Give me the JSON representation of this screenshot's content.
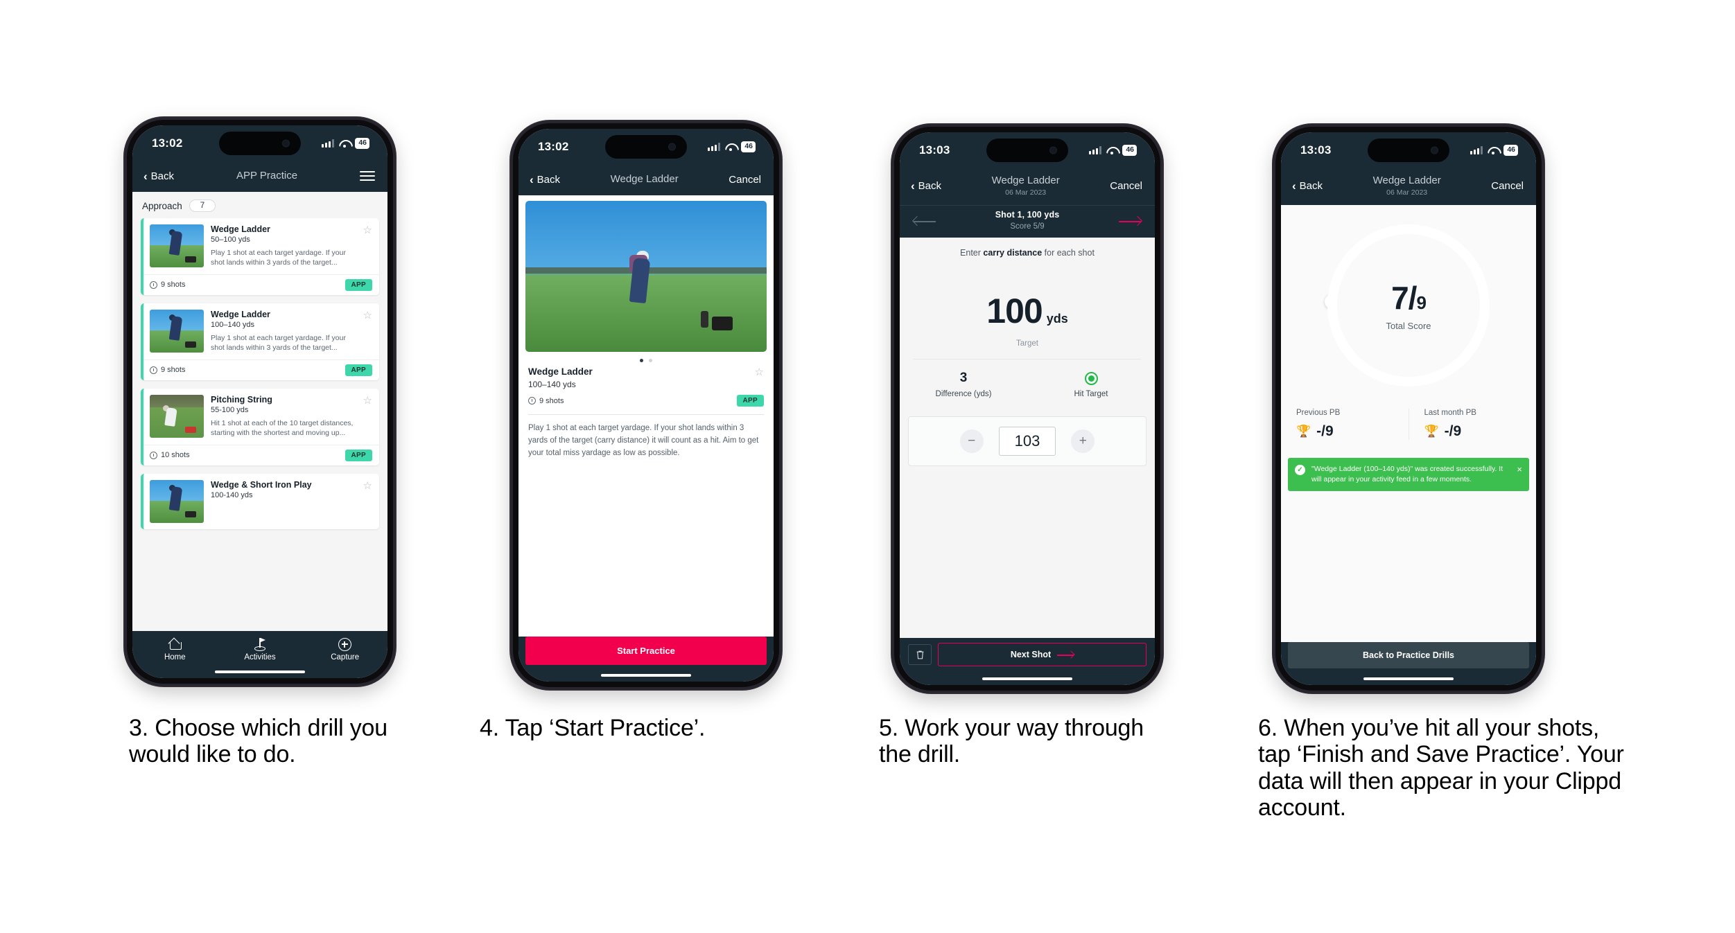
{
  "page": {
    "background": "#ffffff",
    "accent_pink": "#f2004e",
    "accent_teal": "#3ed6ab",
    "dark_navy": "#1b2b36",
    "success_green": "#3cbf4e"
  },
  "phones": [
    {
      "status": {
        "time": "13:02",
        "battery": "46"
      },
      "nav": {
        "back": "Back",
        "title": "APP Practice",
        "menu": "hamburger-icon"
      },
      "section": {
        "title": "Approach",
        "count": "7"
      },
      "cards": [
        {
          "title": "Wedge Ladder",
          "yards": "50–100 yds",
          "desc": "Play 1 shot at each target yardage. If your shot lands within 3 yards of the target...",
          "shots": "9 shots",
          "tag": "APP"
        },
        {
          "title": "Wedge Ladder",
          "yards": "100–140 yds",
          "desc": "Play 1 shot at each target yardage. If your shot lands within 3 yards of the target...",
          "shots": "9 shots",
          "tag": "APP"
        },
        {
          "title": "Pitching String",
          "yards": "55-100 yds",
          "desc": "Hit 1 shot at each of the 10 target distances, starting with the shortest and moving up...",
          "shots": "10 shots",
          "tag": "APP"
        },
        {
          "title": "Wedge & Short Iron Play",
          "yards": "100-140 yds",
          "desc": "",
          "shots": "",
          "tag": ""
        }
      ],
      "tabs": [
        {
          "label": "Home",
          "icon": "home-icon"
        },
        {
          "label": "Activities",
          "icon": "golf-flag-icon"
        },
        {
          "label": "Capture",
          "icon": "plus-circle-icon"
        }
      ]
    },
    {
      "status": {
        "time": "13:02",
        "battery": "46"
      },
      "nav": {
        "back": "Back",
        "title": "Wedge Ladder",
        "cancel": "Cancel"
      },
      "detail": {
        "title": "Wedge Ladder",
        "yards": "100–140 yds",
        "shots": "9 shots",
        "tag": "APP",
        "description": "Play 1 shot at each target yardage. If your shot lands within 3 yards of the target (carry distance) it will count as a hit. Aim to get your total miss yardage as low as possible."
      },
      "cta": "Start Practice"
    },
    {
      "status": {
        "time": "13:03",
        "battery": "46"
      },
      "nav": {
        "back": "Back",
        "title": "Wedge Ladder",
        "subtitle": "06 Mar 2023",
        "cancel": "Cancel"
      },
      "shotnav": {
        "title": "Shot 1, 100 yds",
        "score": "Score 5/9"
      },
      "prompt_before": "Enter ",
      "prompt_bold": "carry distance",
      "prompt_after": " for each shot",
      "target": {
        "value": "100",
        "unit": "yds",
        "label": "Target"
      },
      "stats": [
        {
          "value": "3",
          "label": "Difference (yds)"
        },
        {
          "value": "hit-target-icon",
          "label": "Hit Target"
        }
      ],
      "stepper": {
        "minus": "−",
        "value": "103",
        "plus": "+"
      },
      "footer": {
        "delete": "trash-icon",
        "next": "Next Shot"
      }
    },
    {
      "status": {
        "time": "13:03",
        "battery": "46"
      },
      "nav": {
        "back": "Back",
        "title": "Wedge Ladder",
        "subtitle": "06 Mar 2023",
        "cancel": "Cancel"
      },
      "score": {
        "value": "7",
        "divider": "/",
        "total": "9",
        "label": "Total Score",
        "percent": 78
      },
      "pbs": [
        {
          "label": "Previous PB",
          "value": "-/9",
          "icon": "trophy-icon"
        },
        {
          "label": "Last month PB",
          "value": "-/9",
          "icon": "trophy-icon"
        }
      ],
      "toast": {
        "message": "\"Wedge Ladder (100–140 yds)\" was created successfully. It will appear in your activity feed in a few moments.",
        "close": "×",
        "check": "✓"
      },
      "cta": "Back to Practice Drills"
    }
  ],
  "captions": [
    "3. Choose which drill you would like to do.",
    "4. Tap ‘Start Practice’.",
    "5. Work your way through the drill.",
    "6. When you’ve hit all your shots, tap ‘Finish and Save Practice’. Your data will then appear in your Clippd account."
  ]
}
